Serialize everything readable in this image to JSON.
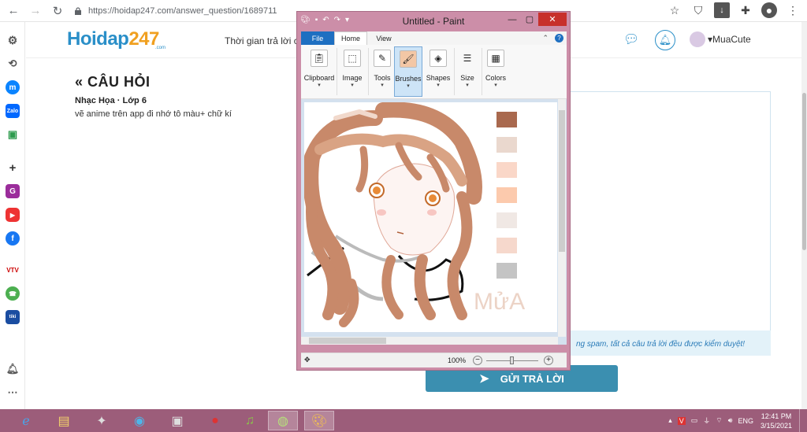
{
  "browser": {
    "url": "https://hoidap247.com/answer_question/1689711"
  },
  "site": {
    "logo_main": "Hoidap",
    "logo_num": "247",
    "logo_sub": ".com",
    "header_text": "Thời gian trả lời c",
    "username": "MuaCute"
  },
  "question": {
    "heading": "CÂU HỎI",
    "subject": "Nhạc Họa · Lớp 6",
    "text": "vẽ anime trên app đi nhớ tô màu+ chữ kí"
  },
  "answer": {
    "spam_note": "ng spam, tất cả câu trả lời đều được kiểm duyệt!",
    "submit_label": "GỬI TRẢ LỜI"
  },
  "paint": {
    "title": "Untitled - Paint",
    "tabs": [
      "File",
      "Home",
      "View"
    ],
    "groups": [
      "Clipboard",
      "Image",
      "Tools",
      "Brushes",
      "Shapes",
      "Size",
      "Colors"
    ],
    "zoom": "100%",
    "signature": "MửA",
    "swatches": [
      "#a9694e",
      "#ead8ce",
      "#fad7c8",
      "#fccaad",
      "#f0e8e4",
      "#f6d8cc",
      "#c4c4c4"
    ]
  },
  "taskbar": {
    "lang": "ENG",
    "time": "12:41 PM",
    "date": "3/15/2021"
  }
}
